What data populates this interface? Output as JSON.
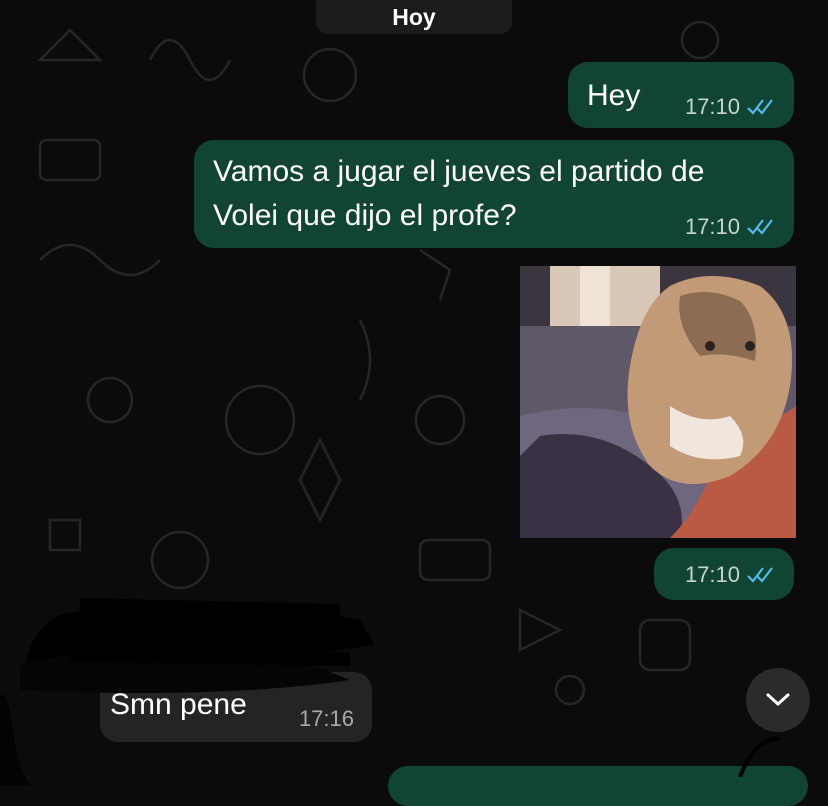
{
  "header": {
    "date_label": "Hoy"
  },
  "messages": [
    {
      "direction": "outgoing",
      "type": "text",
      "text": "Hey",
      "time": "17:10",
      "status": "read"
    },
    {
      "direction": "outgoing",
      "type": "text",
      "line1": "Vamos a jugar el jueves el partido de",
      "line2": "Volei que dijo el profe?",
      "time": "17:10",
      "status": "read"
    },
    {
      "direction": "outgoing",
      "type": "gif",
      "description_icon": "cat-gif",
      "time": "17:10",
      "status": "read"
    },
    {
      "direction": "incoming",
      "type": "text",
      "text": "Smn pene",
      "time": "17:16"
    }
  ],
  "controls": {
    "scroll_down_icon": "chevron-down-icon"
  },
  "colors": {
    "background": "#0b0b0b",
    "outgoing_bubble": "#114433",
    "incoming_bubble": "#242424",
    "read_ticks": "#53bdeb"
  }
}
